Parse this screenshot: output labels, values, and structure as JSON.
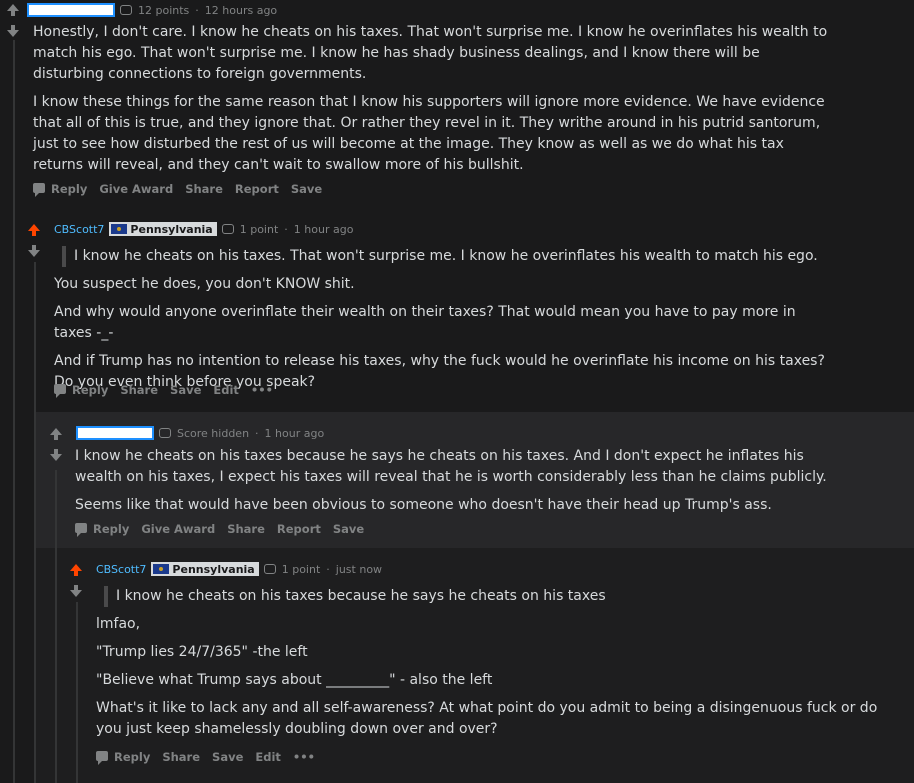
{
  "comments": [
    {
      "points": "12 points",
      "time": "12 hours ago",
      "paragraphs": [
        "Honestly, I don't care. I know he cheats on his taxes. That won't surprise me. I know he overinflates his wealth to match his ego. That won't surprise me. I know he has shady business dealings, and I know there will be disturbing connections to foreign governments.",
        "I know these things for the same reason that I know his supporters will ignore more evidence. We have evidence that all of this is true, and they ignore that. Or rather they revel in it. They writhe around in his putrid santorum, just to see how disturbed the rest of us will become at the image. They know as well as we do what his tax returns will reveal, and they can't wait to swallow more of his bullshit."
      ],
      "actions": [
        "Reply",
        "Give Award",
        "Share",
        "Report",
        "Save"
      ]
    },
    {
      "author": "CBScott7",
      "flair": "Pennsylvania",
      "points": "1 point",
      "time": "1 hour ago",
      "quote": "I know he cheats on his taxes. That won't surprise me. I know he overinflates his wealth to match his ego.",
      "paragraphs": [
        "You suspect he does, you don't KNOW shit.",
        "And why would anyone overinflate their wealth on their taxes? That would mean you have to pay more in taxes -_-",
        "And if Trump has no intention to release his taxes, why the fuck would he overinflate his income on his taxes? Do you even think before you speak?"
      ],
      "actions": [
        "Reply",
        "Share",
        "Save",
        "Edit",
        "•••"
      ]
    },
    {
      "points": "Score hidden",
      "time": "1 hour ago",
      "paragraphs": [
        "I know he cheats on his taxes because he says he cheats on his taxes. And I don't expect he inflates his wealth on his taxes, I expect his taxes will reveal that he is worth considerably less than he claims publicly.",
        "Seems like that would have been obvious to someone who doesn't have their head up Trump's ass."
      ],
      "actions": [
        "Reply",
        "Give Award",
        "Share",
        "Report",
        "Save"
      ]
    },
    {
      "author": "CBScott7",
      "flair": "Pennsylvania",
      "points": "1 point",
      "time": "just now",
      "quote": "I know he cheats on his taxes because he says he cheats on his taxes",
      "paragraphs": [
        "lmfao,",
        "\"Trump lies 24/7/365\" -the left",
        "\"Believe what Trump says about _________\" - also the left",
        "What's it like to lack any and all self-awareness? At what point do you admit to being a disingenuous fuck or do you just keep shamelessly doubling down over and over?"
      ],
      "actions": [
        "Reply",
        "Share",
        "Save",
        "Edit",
        "•••"
      ]
    }
  ],
  "colors": {
    "upvoted": "#ff4500",
    "author": "#4fbcff",
    "text": "#d7dadc",
    "muted": "#818384"
  }
}
